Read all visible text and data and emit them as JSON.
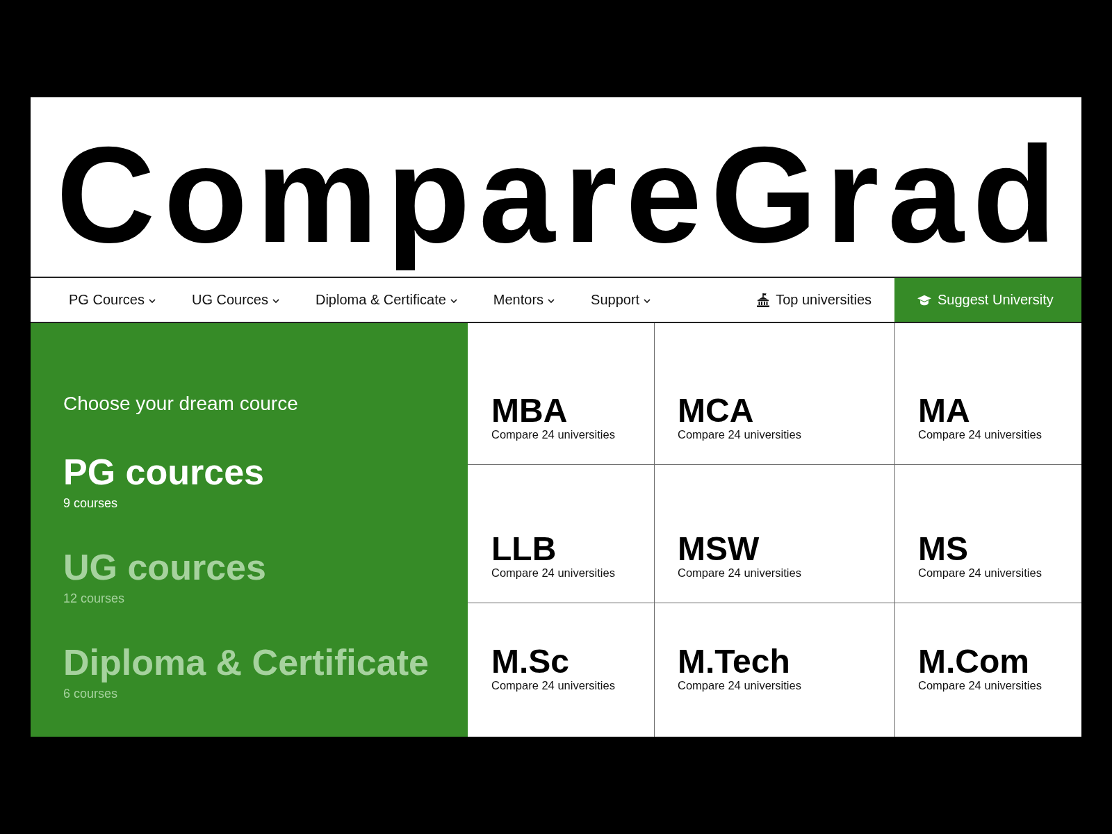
{
  "logo": "CompareGrad",
  "nav": [
    {
      "kind": "dropdown",
      "label": "PG Cources"
    },
    {
      "kind": "dropdown",
      "label": "UG Cources"
    },
    {
      "kind": "dropdown",
      "label": "Diploma & Certificate"
    },
    {
      "kind": "dropdown",
      "label": "Mentors"
    },
    {
      "kind": "dropdown",
      "label": "Support"
    },
    {
      "kind": "link",
      "label": "Top universities"
    },
    {
      "kind": "button",
      "label": "Suggest University"
    }
  ],
  "categories": {
    "heading": "Choose your dream cource",
    "items": [
      {
        "title": "PG cources",
        "count": "9 courses",
        "selected": true
      },
      {
        "title": "UG cources",
        "count": "12 courses",
        "selected": false
      },
      {
        "title": "Diploma & Certificate",
        "count": "6 courses",
        "selected": false
      }
    ]
  },
  "courses": [
    {
      "name": "MBA",
      "subtitle": "Compare 24 universities"
    },
    {
      "name": "MCA",
      "subtitle": "Compare 24 universities"
    },
    {
      "name": "MA",
      "subtitle": "Compare 24 universities"
    },
    {
      "name": "LLB",
      "subtitle": "Compare 24 universities"
    },
    {
      "name": "MSW",
      "subtitle": "Compare 24 universities"
    },
    {
      "name": "MS",
      "subtitle": "Compare 24 universities"
    },
    {
      "name": "M.Sc",
      "subtitle": "Compare 24 universities"
    },
    {
      "name": "M.Tech",
      "subtitle": "Compare 24 universities"
    },
    {
      "name": "M.Com",
      "subtitle": "Compare 24 universities"
    }
  ]
}
